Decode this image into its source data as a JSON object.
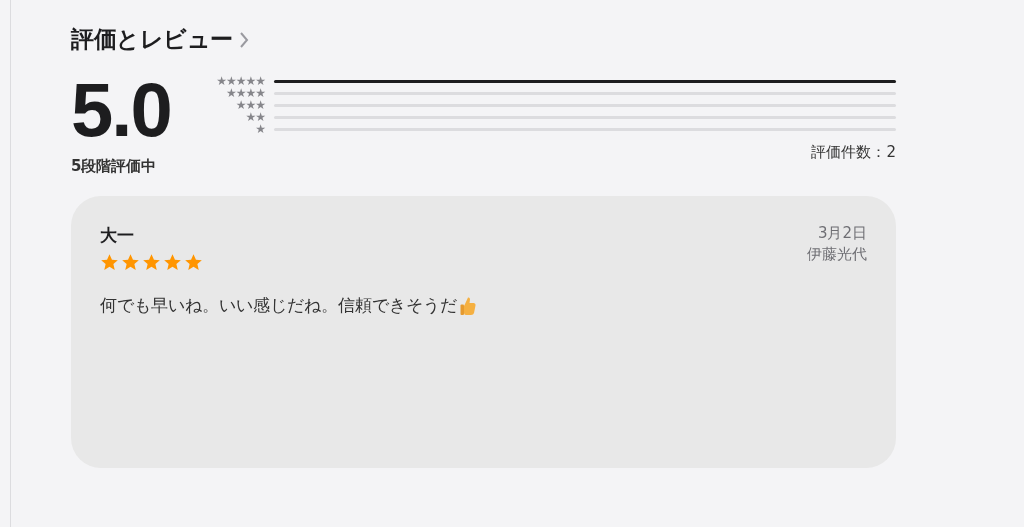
{
  "section": {
    "title": "評価とレビュー"
  },
  "summary": {
    "score": "5.0",
    "scale_label": "5段階評価中",
    "count_label": "評価件数：2",
    "distribution": [
      {
        "label": "★★★★★",
        "level": 1
      },
      {
        "label": "★★★★"
      },
      {
        "label": "★★★"
      },
      {
        "label": "★★"
      },
      {
        "label": "★"
      }
    ]
  },
  "reviews": [
    {
      "title": "大一",
      "stars": 5,
      "date": "3月2日",
      "author": "伊藤光代",
      "body": "何でも早いね。いい感じだね。信頼できそうだ"
    }
  ]
}
